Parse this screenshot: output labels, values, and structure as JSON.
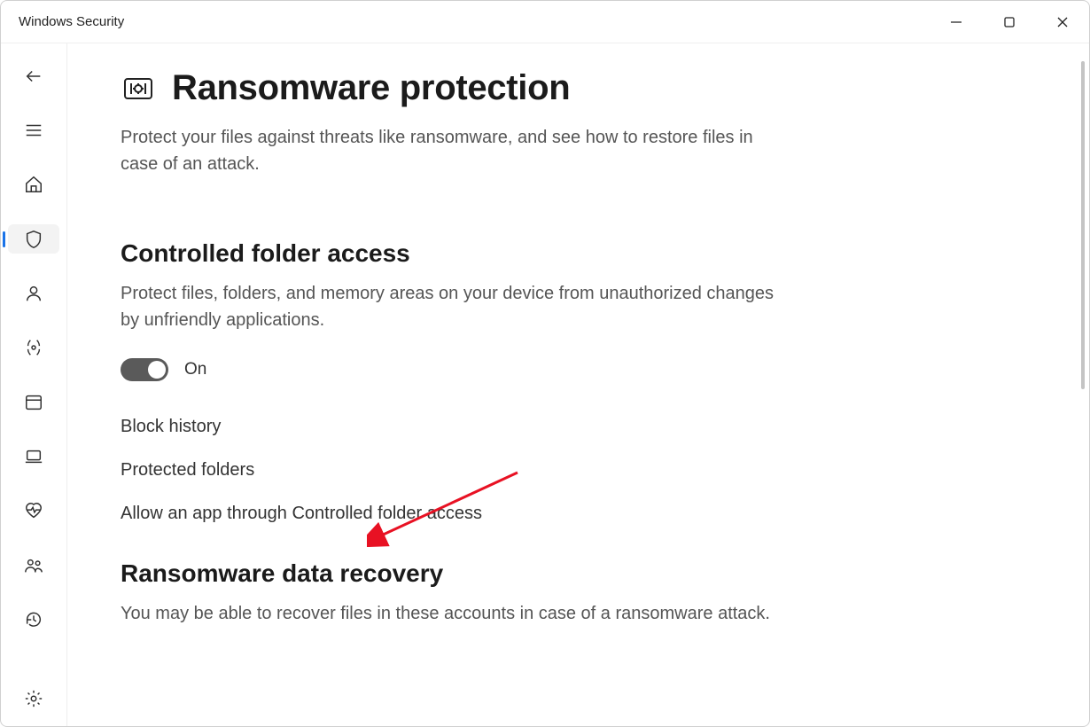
{
  "window": {
    "title": "Windows Security"
  },
  "sidebar": {
    "items": [
      {
        "name": "back-button"
      },
      {
        "name": "nav-menu-button"
      },
      {
        "name": "nav-home"
      },
      {
        "name": "nav-virus-threat",
        "selected": true
      },
      {
        "name": "nav-account-protection"
      },
      {
        "name": "nav-firewall-network"
      },
      {
        "name": "nav-app-browser"
      },
      {
        "name": "nav-device-security"
      },
      {
        "name": "nav-device-performance"
      },
      {
        "name": "nav-family-options"
      },
      {
        "name": "nav-protection-history"
      }
    ],
    "settings": "nav-settings"
  },
  "page": {
    "title": "Ransomware protection",
    "description": "Protect your files against threats like ransomware, and see how to restore files in case of an attack."
  },
  "controlled_folder": {
    "title": "Controlled folder access",
    "description": "Protect files, folders, and memory areas on your device from unauthorized changes by unfriendly applications.",
    "toggle_state": "On",
    "links": {
      "block_history": "Block history",
      "protected_folders": "Protected folders",
      "allow_app": "Allow an app through Controlled folder access"
    }
  },
  "data_recovery": {
    "title": "Ransomware data recovery",
    "description": "You may be able to recover files in these accounts in case of a ransomware attack."
  }
}
